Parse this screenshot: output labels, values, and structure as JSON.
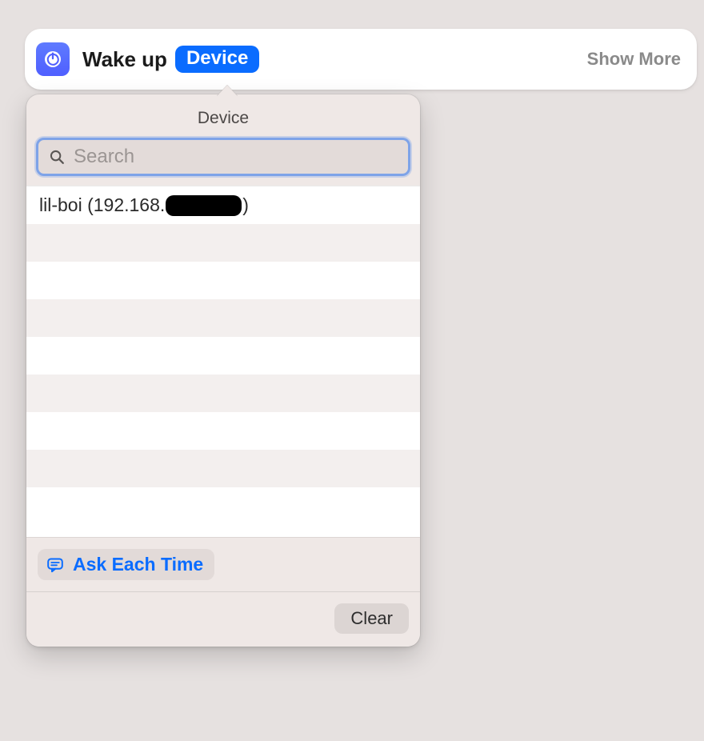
{
  "action": {
    "icon": "power-icon",
    "label": "Wake up",
    "param_badge": "Device",
    "show_more": "Show More"
  },
  "popover": {
    "title": "Device",
    "search": {
      "placeholder": "Search",
      "value": ""
    },
    "items": [
      {
        "name": "lil-boi",
        "ip_prefix": "192.168.",
        "ip_redacted": true
      }
    ],
    "empty_rows": 8,
    "ask_each_time_label": "Ask Each Time",
    "clear_label": "Clear"
  }
}
